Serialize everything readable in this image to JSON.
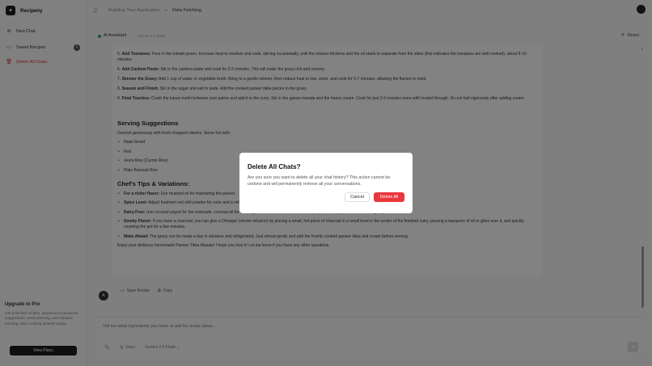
{
  "brand": {
    "name": "Recipeny"
  },
  "sidebar": {
    "items": [
      {
        "label": "New Chat",
        "icon": "plus-icon"
      },
      {
        "label": "Saved Recipes",
        "icon": "bookmark-icon",
        "badge": "1"
      },
      {
        "label": "Delete All Chats",
        "icon": "trash-icon"
      }
    ],
    "upgrade": {
      "title": "Upgrade to Pro",
      "text": "Get unlimited recipes, advanced AI-powered suggestions, meal planning, and nutrition tracking. Start cooking smarter today!",
      "button": "View Plans"
    }
  },
  "breadcrumb": {
    "parent": "Building Your Application",
    "separator": ">",
    "current": "Data Fetching"
  },
  "chat": {
    "assistant": "AI Assistant",
    "model": "Gemini 2.5 Flash",
    "reset": "Reset"
  },
  "message": {
    "steps": [
      {
        "label": "Add Tomatoes:",
        "text": " Pour in the tomato puree. Increase heat to medium and cook, stirring occasionally, until the mixture thickens and the oil starts to separate from the sides (this indicates the tomatoes are well-cooked), about 8-10 minutes."
      },
      {
        "label": "Add Cashew Paste:",
        "text": " Stir in the cashew paste and cook for 2-3 minutes. This will make the gravy rich and creamy."
      },
      {
        "label": "Simmer the Gravy:",
        "text": " Add 1 cup of water or vegetable broth. Bring to a gentle simmer, then reduce heat to low, cover, and cook for 5-7 minutes, allowing the flavors to meld."
      },
      {
        "label": "Season and Finish:",
        "text": " Stir in the sugar and salt to taste. Add the cooked paneer tikka pieces to the gravy."
      },
      {
        "label": "Final Touches:",
        "text": " Crush the kasuri methi between your palms and add it to the curry. Stir in the garam masala and the heavy cream. Cook for just 2-3 minutes more with heated through. Do not boil vigorously after adding cream."
      }
    ],
    "step_numbers": [
      "5.",
      "6.",
      "7.",
      "8.",
      "9."
    ],
    "serving_title": "Serving Suggestions",
    "serving_intro": "Garnish generously with fresh chopped cilantro. Serve hot with:",
    "serving_items": [
      "Naan bread",
      "Roti",
      "Jeera Rice (Cumin Rice)",
      "Plain Basmati Rice"
    ],
    "tips_title": "Chef's Tips & Variations:",
    "tips": [
      {
        "label": "For a richer flavor:",
        "text": " Use mustard oil for marinating the paneer."
      },
      {
        "label": "Spice Level:",
        "text": " Adjust Kashmiri red chili powder for color and a mild kick. For more heat, add a pinch of regular red chili powder."
      },
      {
        "label": "Dairy-Free:",
        "text": " Use coconut yogurt for the marinade, coconut oil for cooking, and coconut cream instead of heavy cream. Skip the butter in the gravy."
      },
      {
        "label": "Smoky Flavor:",
        "text": " If you have a charcoal, you can give a Dhungar (smoke infusion) by placing a small, hot piece of charcoal in a small bowl in the center of the finished curry, pouring a teaspoon of oil or ghee over it, and quickly covering the pot for a few minutes."
      },
      {
        "label": "Make Ahead:",
        "text": " The gravy can be made a day in advance and refrigerated. Just reheat gently and add the freshly cooked paneer tikka and cream before serving."
      }
    ],
    "closing": "Enjoy your delicious homemade Paneer Tikka Masala! I hope you love it! Let me know if you have any other questions.",
    "avatar": "A",
    "save_label": "Save Recipe",
    "copy_label": "Copy"
  },
  "input": {
    "placeholder": "Tell me what ingredients you have or ask for recipe ideas...",
    "voice_label": "Voice",
    "model_label": "Gemini 2.5 Flash"
  },
  "modal": {
    "title": "Delete All Chats?",
    "body": "Are you sure you want to delete all your chat history? This action cannot be undone and will permanently remove all your conversations.",
    "cancel": "Cancel",
    "confirm": "Delete All"
  },
  "colors": {
    "danger": "#e9383d",
    "online": "#2eaa55",
    "primary": "#1e1e1e"
  }
}
